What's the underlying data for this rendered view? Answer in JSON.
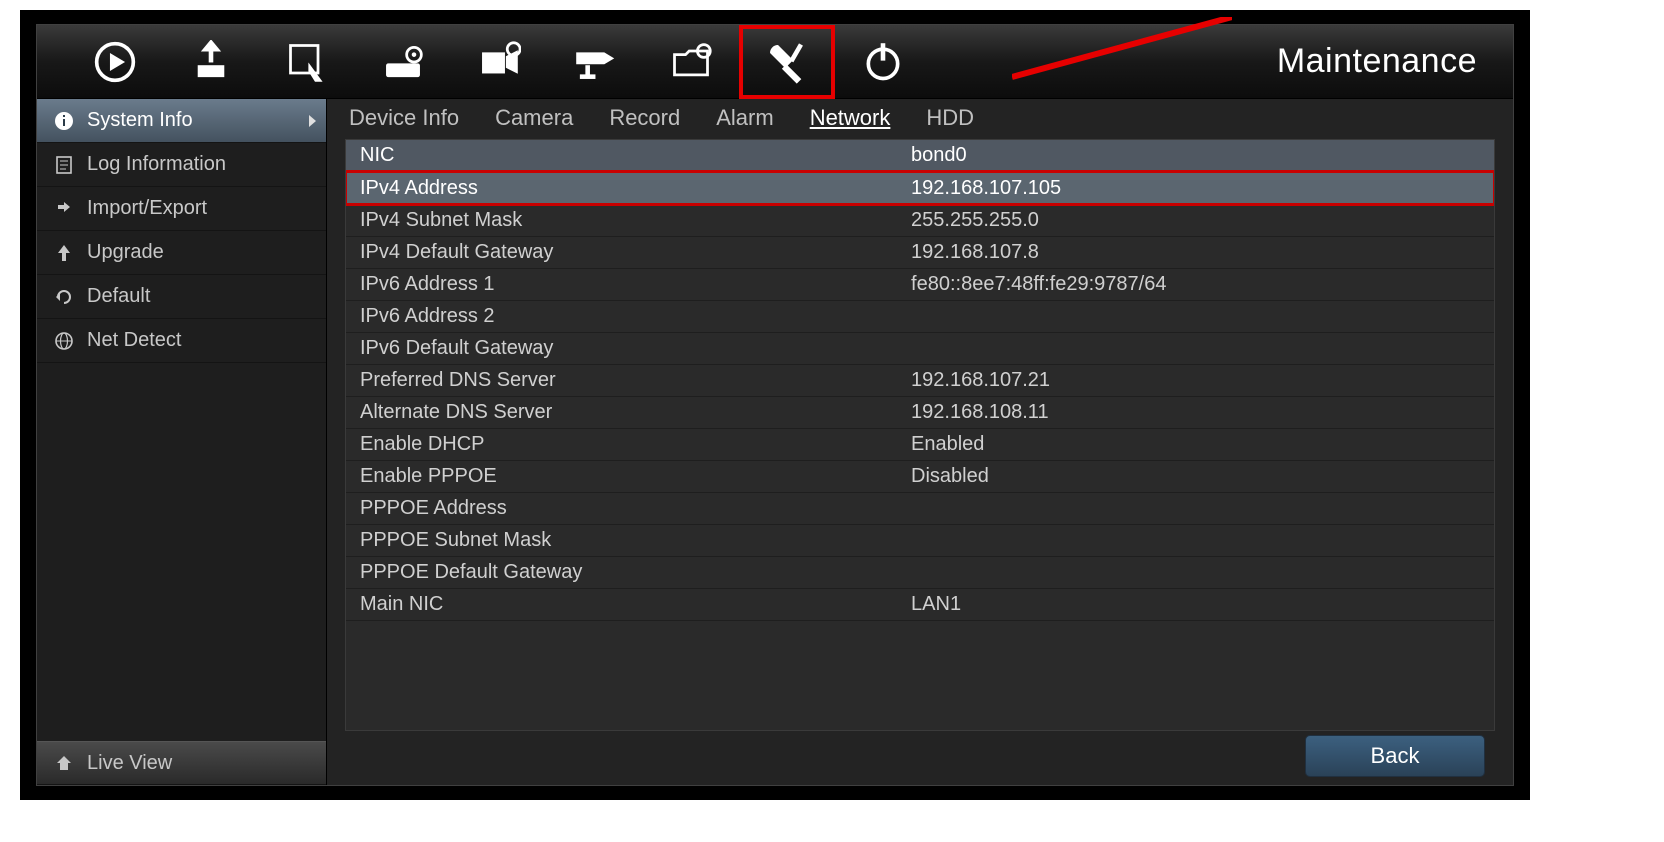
{
  "screen_title": "Maintenance",
  "toolbar_icons": [
    {
      "name": "play-icon"
    },
    {
      "name": "export-icon"
    },
    {
      "name": "touch-screen-icon"
    },
    {
      "name": "disk-config-icon"
    },
    {
      "name": "record-config-icon"
    },
    {
      "name": "camera-config-icon"
    },
    {
      "name": "folder-config-icon"
    },
    {
      "name": "maintenance-tools-icon"
    },
    {
      "name": "power-icon"
    }
  ],
  "sidebar": {
    "items": [
      {
        "label": "System Info",
        "icon": "info-icon",
        "active": true
      },
      {
        "label": "Log Information",
        "icon": "log-icon"
      },
      {
        "label": "Import/Export",
        "icon": "import-export-icon"
      },
      {
        "label": "Upgrade",
        "icon": "upgrade-icon"
      },
      {
        "label": "Default",
        "icon": "default-icon"
      },
      {
        "label": "Net Detect",
        "icon": "net-detect-icon"
      }
    ],
    "live_view_label": "Live View"
  },
  "tabs": [
    {
      "label": "Device Info"
    },
    {
      "label": "Camera"
    },
    {
      "label": "Record"
    },
    {
      "label": "Alarm"
    },
    {
      "label": "Network",
      "active": true
    },
    {
      "label": "HDD"
    }
  ],
  "network_table": {
    "header": {
      "label": "NIC",
      "value": "bond0"
    },
    "highlighted_row_index": 0,
    "rows": [
      {
        "label": "IPv4 Address",
        "value": "192.168.107.105"
      },
      {
        "label": "IPv4 Subnet Mask",
        "value": "255.255.255.0"
      },
      {
        "label": "IPv4 Default Gateway",
        "value": "192.168.107.8"
      },
      {
        "label": "IPv6 Address 1",
        "value": "fe80::8ee7:48ff:fe29:9787/64"
      },
      {
        "label": "IPv6 Address 2",
        "value": ""
      },
      {
        "label": "IPv6 Default Gateway",
        "value": ""
      },
      {
        "label": "Preferred DNS Server",
        "value": "192.168.107.21"
      },
      {
        "label": "Alternate DNS Server",
        "value": "192.168.108.11"
      },
      {
        "label": "Enable DHCP",
        "value": "Enabled"
      },
      {
        "label": "Enable PPPOE",
        "value": "Disabled"
      },
      {
        "label": "PPPOE Address",
        "value": ""
      },
      {
        "label": "PPPOE Subnet Mask",
        "value": ""
      },
      {
        "label": "PPPOE Default Gateway",
        "value": ""
      },
      {
        "label": "Main NIC",
        "value": "LAN1"
      }
    ]
  },
  "footer": {
    "back_label": "Back"
  }
}
